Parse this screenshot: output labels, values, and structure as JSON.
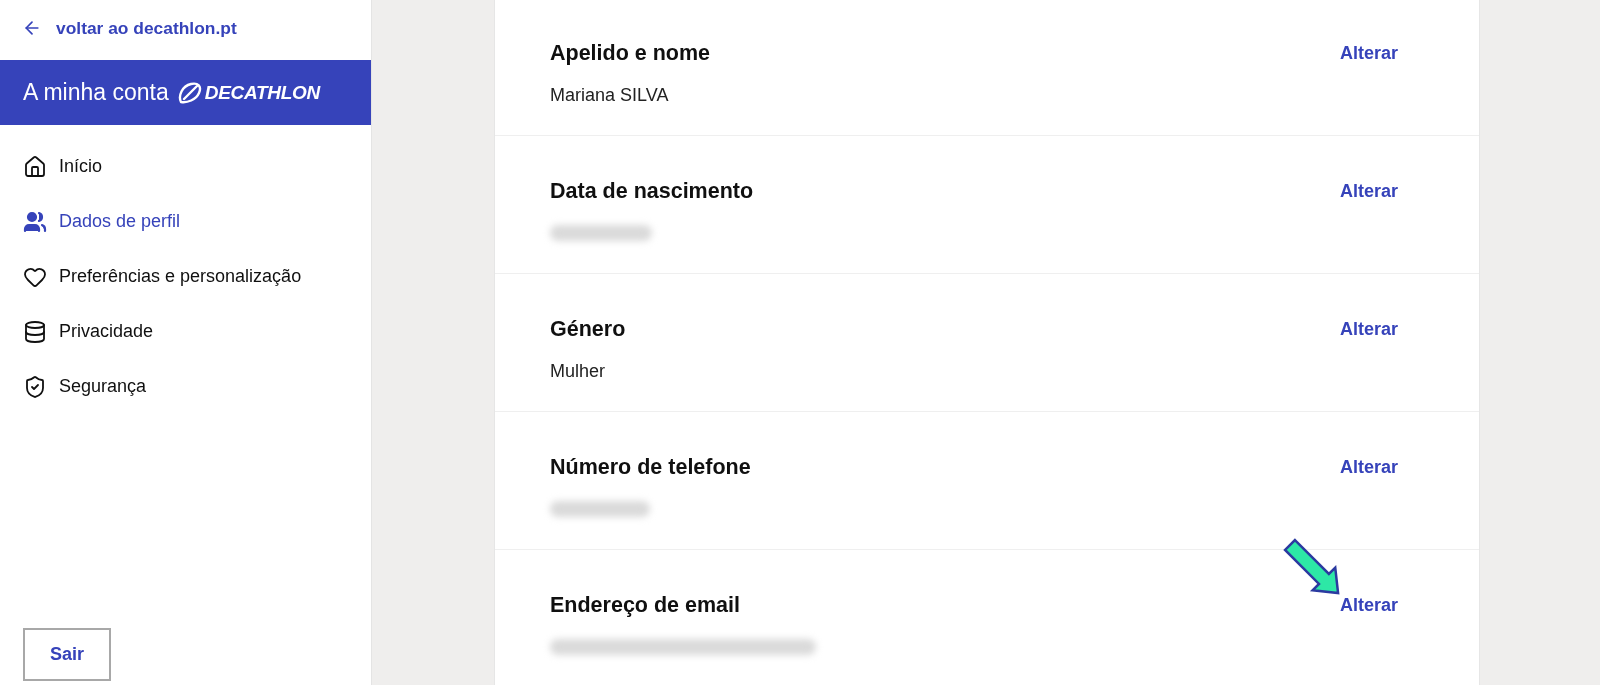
{
  "back_link": {
    "label": "voltar ao decathlon.pt"
  },
  "header": {
    "title": "A minha conta",
    "brand": "DECATHLON"
  },
  "nav": [
    {
      "label": "Início",
      "selected": false
    },
    {
      "label": "Dados de perfil",
      "selected": true
    },
    {
      "label": "Preferências e personalização",
      "selected": false
    },
    {
      "label": "Privacidade",
      "selected": false
    },
    {
      "label": "Segurança",
      "selected": false
    }
  ],
  "logout_button": "Sair",
  "profile_fields": [
    {
      "label": "Apelido e nome",
      "blurred": false,
      "value": "Mariana SILVA",
      "action": "Alterar",
      "highlighted": false
    },
    {
      "label": "Data de nascimento",
      "blurred": true,
      "action": "Alterar",
      "highlighted": false
    },
    {
      "label": "Género",
      "blurred": false,
      "value": "Mulher",
      "action": "Alterar",
      "highlighted": false
    },
    {
      "label": "Número de telefone",
      "blurred": true,
      "action": "Alterar",
      "highlighted": false
    },
    {
      "label": "Endereço de email",
      "blurred": true,
      "action": "Alterar",
      "highlighted": true
    }
  ]
}
